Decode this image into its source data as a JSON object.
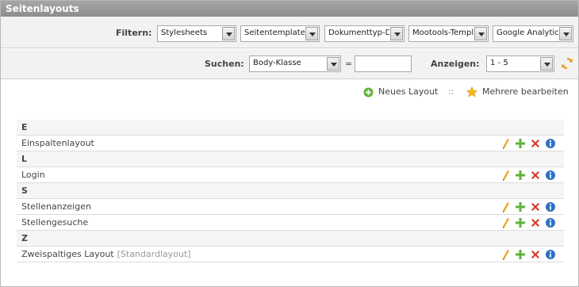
{
  "title": "Seitenlayouts",
  "filter": {
    "label": "Filtern:",
    "selects": [
      {
        "value": "Stylesheets"
      },
      {
        "value": "Seitentemplate"
      },
      {
        "value": "Dokumenttyp-D"
      },
      {
        "value": "Mootools-Templ"
      },
      {
        "value": "Google Analytic"
      }
    ]
  },
  "search": {
    "label": "Suchen:",
    "field_select": "Body-Klasse",
    "equals": "=",
    "input_value": "",
    "show_label": "Anzeigen:",
    "show_select": "1 - 5"
  },
  "actions": {
    "new_layout": "Neues Layout",
    "separator": "::",
    "edit_multiple": "Mehrere bearbeiten"
  },
  "groups": [
    {
      "letter": "E",
      "items": [
        {
          "name": "Einspaltenlayout",
          "note": ""
        }
      ]
    },
    {
      "letter": "L",
      "items": [
        {
          "name": "Login",
          "note": ""
        }
      ]
    },
    {
      "letter": "S",
      "items": [
        {
          "name": "Stellenanzeigen",
          "note": ""
        },
        {
          "name": "Stellengesuche",
          "note": ""
        }
      ]
    },
    {
      "letter": "Z",
      "items": [
        {
          "name": "Zweispaltiges Layout",
          "note": "[Standardlayout]"
        }
      ]
    }
  ]
}
